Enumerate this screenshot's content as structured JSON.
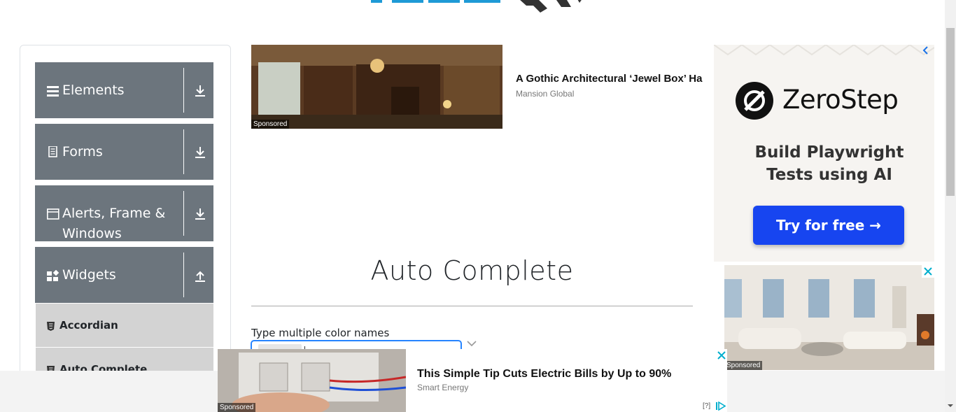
{
  "sidebar": {
    "groups": [
      {
        "label": "Elements",
        "icon": "menu-icon",
        "arrow": "download-arrow-icon"
      },
      {
        "label": "Forms",
        "icon": "document-icon",
        "arrow": "download-arrow-icon"
      },
      {
        "label": "Alerts, Frame & Windows",
        "icon": "window-icon",
        "arrow": "download-arrow-icon"
      },
      {
        "label": "Widgets",
        "icon": "widgets-icon",
        "arrow": "upload-arrow-icon"
      }
    ],
    "items": [
      {
        "label": "Accordian",
        "icon": "html5-icon"
      },
      {
        "label": "Auto Complete",
        "icon": "html5-icon"
      }
    ]
  },
  "top_ad": {
    "title": "A Gothic Architectural ‘Jewel Box’ Ha",
    "source": "Mansion Global",
    "sponsored": "Sponsored"
  },
  "main": {
    "title": "Auto Complete",
    "field_label": "Type multiple color names"
  },
  "right_ad": {
    "brand": "ZeroStep",
    "tagline": "Build Playwright Tests using AI",
    "cta": "Try for free →",
    "sponsored": "Sponsored"
  },
  "bottom_ad": {
    "title": "This Simple Tip Cuts Electric Bills by Up to 90%",
    "source": "Smart Energy",
    "sponsored": "Sponsored",
    "help": "[?]"
  },
  "colors": {
    "sidebar_group_bg": "#6c757d",
    "sidebar_item_bg": "#d3d3d3",
    "cta_blue": "#1745f0",
    "close_cyan": "#00aecd",
    "logo_blue": "#1e9ad6"
  }
}
